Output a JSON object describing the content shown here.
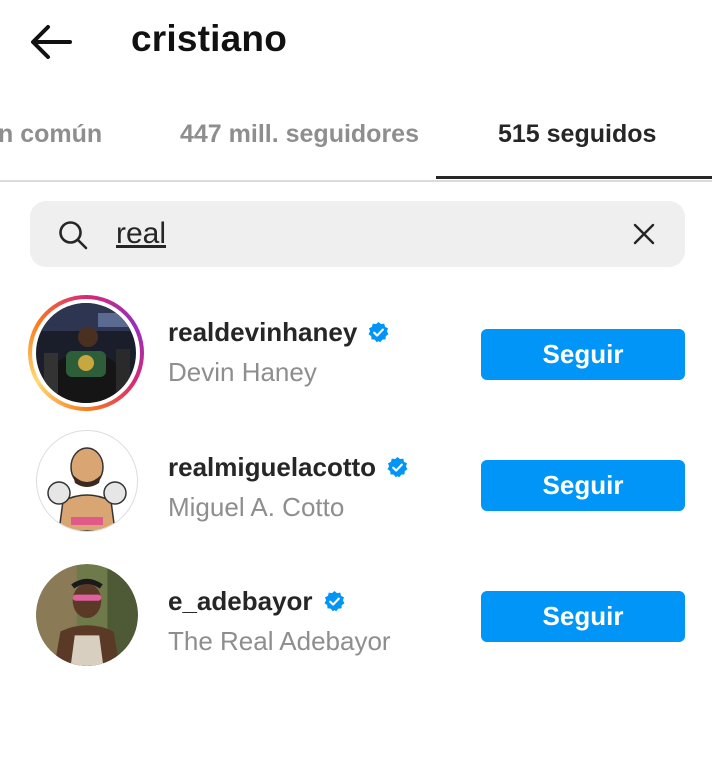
{
  "header": {
    "title": "cristiano",
    "back_icon": "arrow-left-icon"
  },
  "tabs": [
    {
      "label": "n común",
      "active": false
    },
    {
      "label": "447 mill. seguidores",
      "active": false
    },
    {
      "label": "515 seguidos",
      "active": true
    }
  ],
  "search": {
    "value": "real",
    "search_icon": "search-icon",
    "clear_icon": "close-icon"
  },
  "accounts": [
    {
      "username": "realdevinhaney",
      "full_name": "Devin Haney",
      "verified": true,
      "story_ring": true,
      "button": "Seguir"
    },
    {
      "username": "realmiguelacotto",
      "full_name": "Miguel A. Cotto",
      "verified": true,
      "story_ring": false,
      "button": "Seguir"
    },
    {
      "username": "e_adebayor",
      "full_name": "The Real Adebayor",
      "verified": true,
      "story_ring": false,
      "button": "Seguir"
    }
  ],
  "colors": {
    "accent": "#0095f6",
    "text": "#262626",
    "muted": "#8e8e8e",
    "search_bg": "#efefef"
  }
}
